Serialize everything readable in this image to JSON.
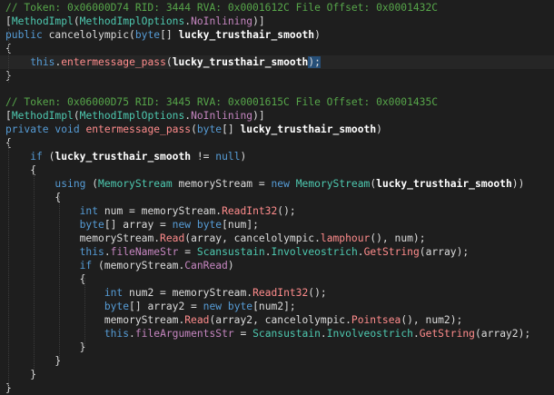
{
  "code_lines": [
    [
      [
        "// Token: 0x06000D74 RID: 3444 RVA: 0x0001612C File Offset: 0x0001432C",
        "comment"
      ]
    ],
    [
      [
        "[",
        "plain"
      ],
      [
        "MethodImpl",
        "type"
      ],
      [
        "(",
        "plain"
      ],
      [
        "MethodImplOptions",
        "type"
      ],
      [
        ".",
        "plain"
      ],
      [
        "NoInlining",
        "prop"
      ],
      [
        ")]",
        "plain"
      ]
    ],
    [
      [
        "public ",
        "kw"
      ],
      [
        "cancelolympic",
        "plain"
      ],
      [
        "(",
        "plain"
      ],
      [
        "byte",
        "kw"
      ],
      [
        "[] ",
        "plain"
      ],
      [
        "lucky_trusthair_smooth",
        "bold"
      ],
      [
        ")",
        "plain"
      ]
    ],
    [
      [
        "{",
        "plain"
      ]
    ],
    [
      [
        "    ",
        "plain"
      ],
      [
        "this",
        "kw"
      ],
      [
        ".",
        "plain"
      ],
      [
        "entermessage_pass",
        "method"
      ],
      [
        "(",
        "plain"
      ],
      [
        "lucky_trusthair_smooth",
        "bold"
      ],
      [
        ");",
        "sel"
      ]
    ],
    [
      [
        "}",
        "plain"
      ]
    ],
    [],
    [
      [
        "// Token: 0x06000D75 RID: 3445 RVA: 0x0001615C File Offset: 0x0001435C",
        "comment"
      ]
    ],
    [
      [
        "[",
        "plain"
      ],
      [
        "MethodImpl",
        "type"
      ],
      [
        "(",
        "plain"
      ],
      [
        "MethodImplOptions",
        "type"
      ],
      [
        ".",
        "plain"
      ],
      [
        "NoInlining",
        "prop"
      ],
      [
        ")]",
        "plain"
      ]
    ],
    [
      [
        "private ",
        "kw"
      ],
      [
        "void ",
        "kw"
      ],
      [
        "entermessage_pass",
        "method"
      ],
      [
        "(",
        "plain"
      ],
      [
        "byte",
        "kw"
      ],
      [
        "[] ",
        "plain"
      ],
      [
        "lucky_trusthair_smooth",
        "bold"
      ],
      [
        ")",
        "plain"
      ]
    ],
    [
      [
        "{",
        "plain"
      ]
    ],
    [
      [
        "    ",
        "plain"
      ],
      [
        "if ",
        "kw"
      ],
      [
        "(",
        "plain"
      ],
      [
        "lucky_trusthair_smooth",
        "bold"
      ],
      [
        " != ",
        "plain"
      ],
      [
        "null",
        "kw"
      ],
      [
        ")",
        "plain"
      ]
    ],
    [
      [
        "    ",
        "plain"
      ],
      [
        "{",
        "plain"
      ]
    ],
    [
      [
        "        ",
        "plain"
      ],
      [
        "using ",
        "kw"
      ],
      [
        "(",
        "plain"
      ],
      [
        "MemoryStream ",
        "type"
      ],
      [
        "memoryStream = ",
        "plain"
      ],
      [
        "new ",
        "kw"
      ],
      [
        "MemoryStream",
        "type"
      ],
      [
        "(",
        "plain"
      ],
      [
        "lucky_trusthair_smooth",
        "bold"
      ],
      [
        "))",
        "plain"
      ]
    ],
    [
      [
        "        ",
        "plain"
      ],
      [
        "{",
        "plain"
      ]
    ],
    [
      [
        "            ",
        "plain"
      ],
      [
        "int ",
        "kw"
      ],
      [
        "num = memoryStream.",
        "plain"
      ],
      [
        "ReadInt32",
        "method"
      ],
      [
        "();",
        "plain"
      ]
    ],
    [
      [
        "            ",
        "plain"
      ],
      [
        "byte",
        "kw"
      ],
      [
        "[] array = ",
        "plain"
      ],
      [
        "new ",
        "kw"
      ],
      [
        "byte",
        "kw"
      ],
      [
        "[num];",
        "plain"
      ]
    ],
    [
      [
        "            ",
        "plain"
      ],
      [
        "memoryStream.",
        "plain"
      ],
      [
        "Read",
        "method"
      ],
      [
        "(array, cancelolympic.",
        "plain"
      ],
      [
        "lamphour",
        "method"
      ],
      [
        "(), num);",
        "plain"
      ]
    ],
    [
      [
        "            ",
        "plain"
      ],
      [
        "this",
        "kw"
      ],
      [
        ".",
        "plain"
      ],
      [
        "fileNameStr",
        "prop"
      ],
      [
        " = ",
        "plain"
      ],
      [
        "Scansustain",
        "type"
      ],
      [
        ".",
        "plain"
      ],
      [
        "Involveostrich",
        "type"
      ],
      [
        ".",
        "plain"
      ],
      [
        "GetString",
        "method"
      ],
      [
        "(array);",
        "plain"
      ]
    ],
    [
      [
        "            ",
        "plain"
      ],
      [
        "if ",
        "kw"
      ],
      [
        "(memoryStream.",
        "plain"
      ],
      [
        "CanRead",
        "prop"
      ],
      [
        ")",
        "plain"
      ]
    ],
    [
      [
        "            ",
        "plain"
      ],
      [
        "{",
        "plain"
      ]
    ],
    [
      [
        "                ",
        "plain"
      ],
      [
        "int ",
        "kw"
      ],
      [
        "num2 = memoryStream.",
        "plain"
      ],
      [
        "ReadInt32",
        "method"
      ],
      [
        "();",
        "plain"
      ]
    ],
    [
      [
        "                ",
        "plain"
      ],
      [
        "byte",
        "kw"
      ],
      [
        "[] array2 = ",
        "plain"
      ],
      [
        "new ",
        "kw"
      ],
      [
        "byte",
        "kw"
      ],
      [
        "[num2];",
        "plain"
      ]
    ],
    [
      [
        "                ",
        "plain"
      ],
      [
        "memoryStream.",
        "plain"
      ],
      [
        "Read",
        "method"
      ],
      [
        "(array2, cancelolympic.",
        "plain"
      ],
      [
        "Pointsea",
        "method"
      ],
      [
        "(), num2);",
        "plain"
      ]
    ],
    [
      [
        "                ",
        "plain"
      ],
      [
        "this",
        "kw"
      ],
      [
        ".",
        "plain"
      ],
      [
        "fileArgumentsStr",
        "prop"
      ],
      [
        " = ",
        "plain"
      ],
      [
        "Scansustain",
        "type"
      ],
      [
        ".",
        "plain"
      ],
      [
        "Involveostrich",
        "type"
      ],
      [
        ".",
        "plain"
      ],
      [
        "GetString",
        "method"
      ],
      [
        "(array2);",
        "plain"
      ]
    ],
    [
      [
        "            ",
        "plain"
      ],
      [
        "}",
        "plain"
      ]
    ],
    [
      [
        "        ",
        "plain"
      ],
      [
        "}",
        "plain"
      ]
    ],
    [
      [
        "    ",
        "plain"
      ],
      [
        "}",
        "plain"
      ]
    ],
    [
      [
        "}",
        "plain"
      ]
    ]
  ],
  "highlighted_line": 4
}
